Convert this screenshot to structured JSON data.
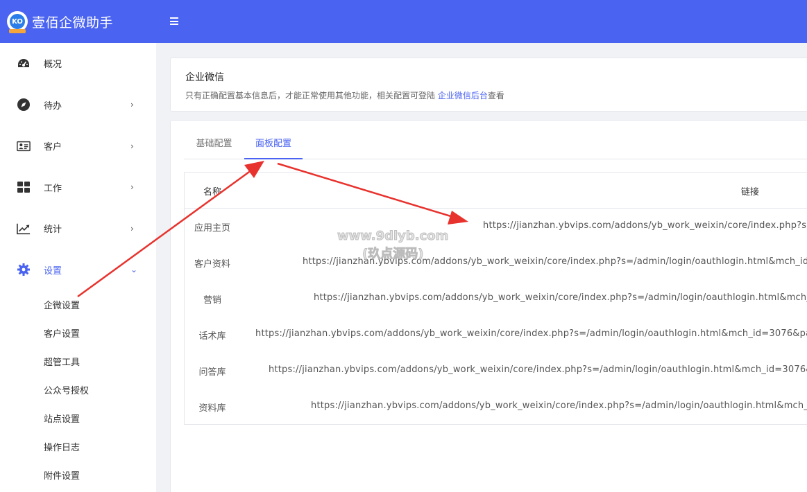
{
  "app": {
    "title": "壹佰企微助手",
    "logo_text": "KO"
  },
  "sidebar": {
    "items": [
      {
        "label": "概况",
        "icon": "dashboard-icon",
        "has_chevron": false
      },
      {
        "label": "待办",
        "icon": "compass-icon",
        "has_chevron": true,
        "chevron": "›"
      },
      {
        "label": "客户",
        "icon": "contact-card-icon",
        "has_chevron": true,
        "chevron": "›"
      },
      {
        "label": "工作",
        "icon": "grid-icon",
        "has_chevron": true,
        "chevron": "›"
      },
      {
        "label": "统计",
        "icon": "trend-chart-icon",
        "has_chevron": true,
        "chevron": "›"
      },
      {
        "label": "设置",
        "icon": "gear-icon",
        "has_chevron": true,
        "chevron": "⌄",
        "active": true
      }
    ],
    "subitems": [
      "企微设置",
      "客户设置",
      "超管工具",
      "公众号授权",
      "站点设置",
      "操作日志",
      "附件设置"
    ]
  },
  "header": {
    "menu_icon": "hamburger-icon"
  },
  "info_card": {
    "title": "企业微信",
    "desc_prefix": "只有正确配置基本信息后，才能正常使用其他功能，相关配置可登陆 ",
    "desc_link": "企业微信后台",
    "desc_suffix": "查看"
  },
  "tabs": [
    {
      "label": "基础配置",
      "active": false
    },
    {
      "label": "面板配置",
      "active": true
    }
  ],
  "table": {
    "columns": [
      "名称",
      "链接"
    ],
    "rows": [
      {
        "name": "应用主页",
        "url": "https://jianzhan.ybvips.com/addons/yb_work_weixin/core/index.php?s="
      },
      {
        "name": "客户资料",
        "url": "https://jianzhan.ybvips.com/addons/yb_work_weixin/core/index.php?s=/admin/login/oauthlogin.html&mch_id"
      },
      {
        "name": "营销",
        "url": "https://jianzhan.ybvips.com/addons/yb_work_weixin/core/index.php?s=/admin/login/oauthlogin.html&mch_"
      },
      {
        "name": "话术库",
        "url": "https://jianzhan.ybvips.com/addons/yb_work_weixin/core/index.php?s=/admin/login/oauthlogin.html&mch_id=3076&pa"
      },
      {
        "name": "问答库",
        "url": "https://jianzhan.ybvips.com/addons/yb_work_weixin/core/index.php?s=/admin/login/oauthlogin.html&mch_id=3076&"
      },
      {
        "name": "资料库",
        "url": "https://jianzhan.ybvips.com/addons/yb_work_weixin/core/index.php?s=/admin/login/oauthlogin.html&mch_"
      }
    ]
  },
  "watermark": {
    "line1": "www.9dlyb.com",
    "line2": "(玖点源码)"
  },
  "colors": {
    "primary": "#4a63f0",
    "annotation_arrow": "#e8322d"
  }
}
